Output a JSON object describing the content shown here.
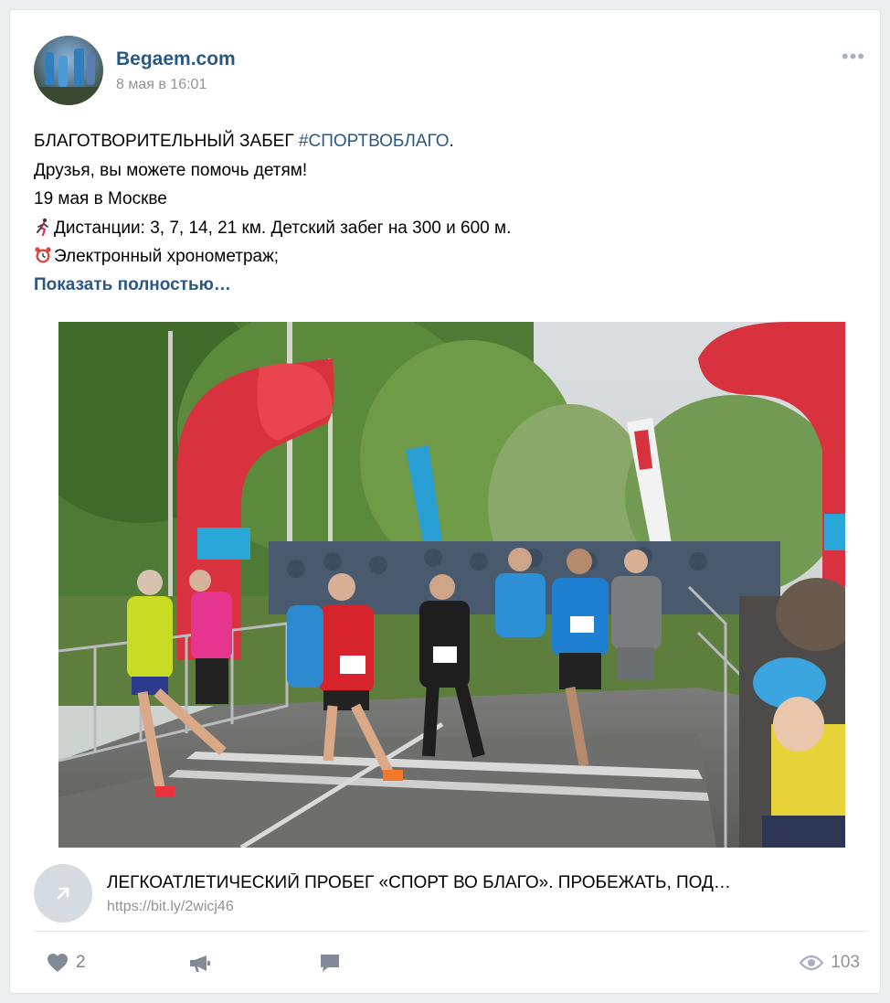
{
  "post": {
    "author": "Begaem.com",
    "date": "8 мая в 16:01",
    "text": {
      "line1_prefix": "БЛАГОТВОРИТЕЛЬНЫЙ ЗАБЕГ ",
      "hashtag": "#СПОРТВОБЛАГО",
      "line1_suffix": ".",
      "line2": "Друзья, вы можете помочь детям!",
      "line3": "19 мая в Москве",
      "line4": "Дистанции: 3, 7, 14, 21 км. Детский забег на 300 и 600 м.",
      "line5": "Электронный хронометраж;"
    },
    "show_more": "Показать полностью…",
    "link": {
      "title": "ЛЕГКОАТЛЕТИЧЕСКИЙ ПРОБЕГ «СПОРТ ВО БЛАГО». ПРОБЕЖАТЬ, ПОД…",
      "url": "https://bit.ly/2wicj46"
    },
    "actions": {
      "likes": "2",
      "views": "103"
    }
  },
  "colors": {
    "link_blue": "#2a5885",
    "meta_gray": "#939393",
    "icon_gray": "#828a99"
  },
  "icons": [
    "more-icon",
    "runner-emoji",
    "alarm-clock-emoji",
    "link-arrow-icon",
    "heart-icon",
    "megaphone-icon",
    "comment-icon",
    "eye-icon"
  ]
}
